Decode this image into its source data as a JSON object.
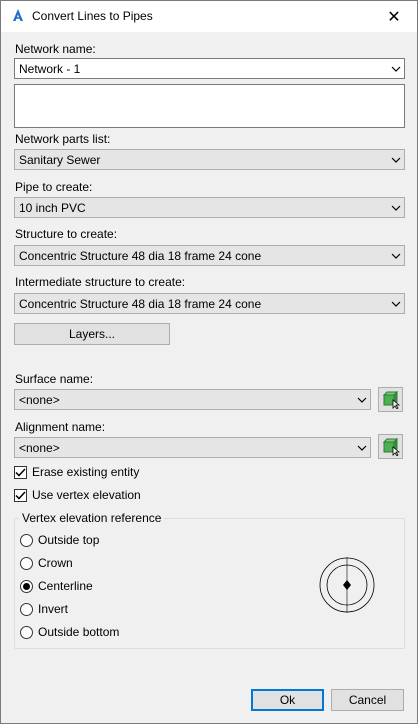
{
  "window": {
    "title": "Convert Lines to Pipes",
    "close_glyph": "✕"
  },
  "network_name": {
    "label": "Network name:",
    "value": "Network - 1"
  },
  "network_parts": {
    "label": "Network parts list:",
    "value": "Sanitary Sewer"
  },
  "pipe": {
    "label": "Pipe to create:",
    "value": "10 inch PVC"
  },
  "structure": {
    "label": "Structure to create:",
    "value": "Concentric Structure 48 dia 18 frame 24 cone"
  },
  "intermediate": {
    "label": "Intermediate structure to create:",
    "value": "Concentric Structure 48 dia 18 frame 24 cone"
  },
  "layers_button": "Layers...",
  "surface": {
    "label": "Surface name:",
    "value": "<none>"
  },
  "alignment": {
    "label": "Alignment name:",
    "value": "<none>"
  },
  "checks": {
    "erase": "Erase existing entity",
    "vertex": "Use vertex elevation"
  },
  "vertex_ref": {
    "title": "Vertex elevation reference",
    "options": [
      "Outside top",
      "Crown",
      "Centerline",
      "Invert",
      "Outside bottom"
    ],
    "selected": "Centerline"
  },
  "buttons": {
    "ok": "Ok",
    "cancel": "Cancel"
  },
  "icons": {
    "app": "autocad-a-icon",
    "pick": "pick-from-drawing-icon",
    "dropdown": "chevron-down-icon"
  }
}
